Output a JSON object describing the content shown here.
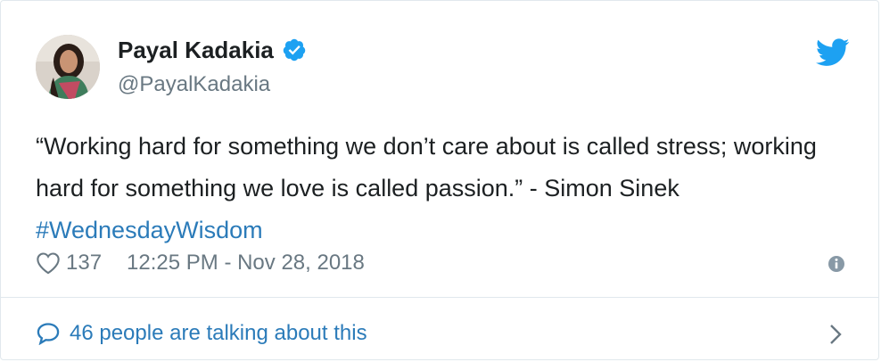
{
  "tweet": {
    "author": {
      "name": "Payal Kadakia",
      "handle": "@PayalKadakia",
      "verified": true
    },
    "text_main": "“Working hard for something we don’t care about is called stress; working hard for something we love is called passion.” - Simon Sinek ",
    "hashtag": "#WednesdayWisdom",
    "likes": "137",
    "timestamp": "12:25 PM - Nov 28, 2018",
    "conversation": "46 people are talking about this"
  },
  "colors": {
    "accent": "#2b7bb9",
    "verified": "#1da1f2",
    "muted": "#697882",
    "text": "#1c2022",
    "divider": "#e1e8ed"
  },
  "icons": [
    "twitter-bird-icon",
    "verified-badge-icon",
    "heart-icon",
    "info-icon",
    "chat-bubble-icon",
    "chevron-right-icon"
  ]
}
